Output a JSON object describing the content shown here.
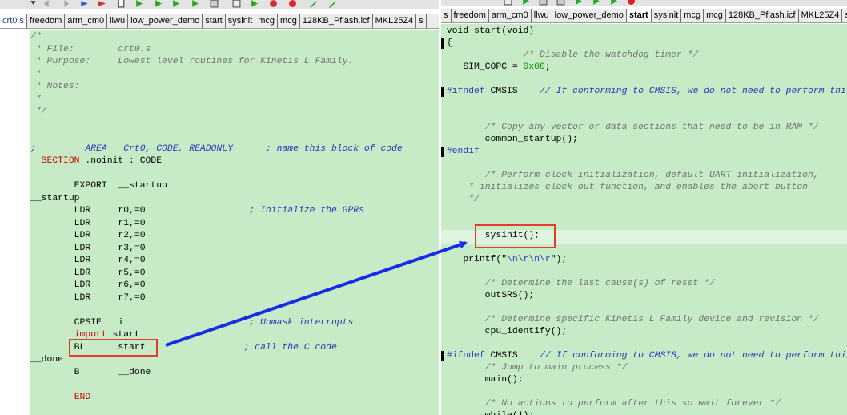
{
  "left": {
    "tabs": [
      "crt0.s",
      "freedom",
      "arm_cm0",
      "llwu",
      "low_power_demo",
      "start",
      "sysinit",
      "mcg",
      "mcg",
      "128KB_Pflash.icf",
      "MKL25Z4",
      "s"
    ],
    "active_tab": 0,
    "lines": [
      [
        [
          "/*",
          "cg"
        ]
      ],
      [
        [
          " * File:        crt0.s",
          "cg"
        ]
      ],
      [
        [
          " * Purpose:     Lowest level routines for Kinetis L Family.",
          "cg"
        ]
      ],
      [
        [
          " *",
          "cg"
        ]
      ],
      [
        [
          " * Notes:",
          "cg"
        ]
      ],
      [
        [
          " *",
          "cg"
        ]
      ],
      [
        [
          " */",
          "cg"
        ]
      ],
      [
        [
          "",
          "df"
        ]
      ],
      [
        [
          "",
          "df"
        ]
      ],
      [
        [
          ";         AREA   Crt0, CODE, READONLY      ; name this block of code",
          "cm"
        ]
      ],
      [
        [
          "  ",
          "df"
        ],
        [
          "SECTION",
          "kw"
        ],
        [
          " .noinit : CODE",
          "df"
        ]
      ],
      [
        [
          "",
          "df"
        ]
      ],
      [
        [
          "        EXPORT  __startup",
          "df"
        ]
      ],
      [
        [
          "__startup",
          "df"
        ]
      ],
      [
        [
          "        LDR     r0,=0                   ",
          "df"
        ],
        [
          "; Initialize the GPRs",
          "cm"
        ]
      ],
      [
        [
          "        LDR     r1,=0",
          "df"
        ]
      ],
      [
        [
          "        LDR     r2,=0",
          "df"
        ]
      ],
      [
        [
          "        LDR     r3,=0",
          "df"
        ]
      ],
      [
        [
          "        LDR     r4,=0",
          "df"
        ]
      ],
      [
        [
          "        LDR     r5,=0",
          "df"
        ]
      ],
      [
        [
          "        LDR     r6,=0",
          "df"
        ]
      ],
      [
        [
          "        LDR     r7,=0",
          "df"
        ]
      ],
      [
        [
          "",
          "df"
        ]
      ],
      [
        [
          "        CPSIE   i                       ",
          "df"
        ],
        [
          "; Unmask interrupts",
          "cm"
        ]
      ],
      [
        [
          "        ",
          "df"
        ],
        [
          "import",
          "kw"
        ],
        [
          " start",
          "df"
        ]
      ],
      [
        [
          "        BL      start                  ",
          "df"
        ],
        [
          "; call the C code",
          "cm"
        ]
      ],
      [
        [
          "__done",
          "df"
        ]
      ],
      [
        [
          "        B       __done",
          "df"
        ]
      ],
      [
        [
          "",
          "df"
        ]
      ],
      [
        [
          "        ",
          "df"
        ],
        [
          "END",
          "kw"
        ]
      ]
    ]
  },
  "right": {
    "tabs": [
      "s",
      "freedom",
      "arm_cm0",
      "llwu",
      "low_power_demo",
      "start",
      "sysinit",
      "mcg",
      "mcg",
      "128KB_Pflash.icf",
      "MKL25Z4",
      "sysinit.s"
    ],
    "active_tab": 5,
    "lines": [
      [
        [
          " void start(void)",
          "df"
        ]
      ],
      [
        [
          " {",
          "df"
        ]
      ],
      [
        [
          "               ",
          "df"
        ],
        [
          "/* Disable the watchdog timer */",
          "cg"
        ]
      ],
      [
        [
          "    SIM_COPC = ",
          "df"
        ],
        [
          "0x00",
          "nm"
        ],
        [
          ";",
          "df"
        ]
      ],
      [
        [
          "",
          "df"
        ]
      ],
      [
        [
          " ",
          "df"
        ],
        [
          "#ifndef",
          "st"
        ],
        [
          " CMSIS    ",
          "df"
        ],
        [
          "// If conforming to CMSIS, we do not need to perform this code",
          "cm"
        ]
      ],
      [
        [
          "",
          "df"
        ]
      ],
      [
        [
          "",
          "df"
        ]
      ],
      [
        [
          "        ",
          "df"
        ],
        [
          "/* Copy any vector or data sections that need to be in RAM */",
          "cg"
        ]
      ],
      [
        [
          "        common_startup();",
          "df"
        ]
      ],
      [
        [
          " ",
          "df"
        ],
        [
          "#endif",
          "st"
        ]
      ],
      [
        [
          "",
          "df"
        ]
      ],
      [
        [
          "        ",
          "df"
        ],
        [
          "/* Perform clock initialization, default UART initialization,",
          "cg"
        ]
      ],
      [
        [
          "     ",
          "df"
        ],
        [
          "* initializes clock out function, and enables the abort button",
          "cg"
        ]
      ],
      [
        [
          "     ",
          "df"
        ],
        [
          "*/",
          "cg"
        ]
      ],
      [
        [
          "",
          "df"
        ]
      ],
      [
        [
          "",
          "df"
        ]
      ],
      [
        [
          "        sysinit();",
          "df"
        ]
      ],
      [
        [
          "",
          "df"
        ]
      ],
      [
        [
          "    printf(\"",
          "df"
        ],
        [
          "\\n\\r\\n\\r",
          "st"
        ],
        [
          "\");",
          "df"
        ]
      ],
      [
        [
          "",
          "df"
        ]
      ],
      [
        [
          "        ",
          "df"
        ],
        [
          "/* Determine the last cause(s) of reset */",
          "cg"
        ]
      ],
      [
        [
          "        outSRS();",
          "df"
        ]
      ],
      [
        [
          "",
          "df"
        ]
      ],
      [
        [
          "        ",
          "df"
        ],
        [
          "/* Determine specific Kinetis L Family device and revision */",
          "cg"
        ]
      ],
      [
        [
          "        cpu_identify();",
          "df"
        ]
      ],
      [
        [
          "",
          "df"
        ]
      ],
      [
        [
          " ",
          "df"
        ],
        [
          "#ifndef",
          "st"
        ],
        [
          " CMSIS    ",
          "df"
        ],
        [
          "// If conforming to CMSIS, we do not need to perform this code",
          "cm"
        ]
      ],
      [
        [
          "        ",
          "df"
        ],
        [
          "/* Jump to main process */",
          "cg"
        ]
      ],
      [
        [
          "        main();",
          "df"
        ]
      ],
      [
        [
          "",
          "df"
        ]
      ],
      [
        [
          "        ",
          "df"
        ],
        [
          "/* No actions to perform after this so wait forever */",
          "cg"
        ]
      ],
      [
        [
          "        while(1);",
          "df"
        ]
      ]
    ]
  },
  "colors": {
    "editor_background": "#c6ebc6",
    "annotation_box": "#e33b2c",
    "annotation_arrow": "#1a2ce6"
  }
}
